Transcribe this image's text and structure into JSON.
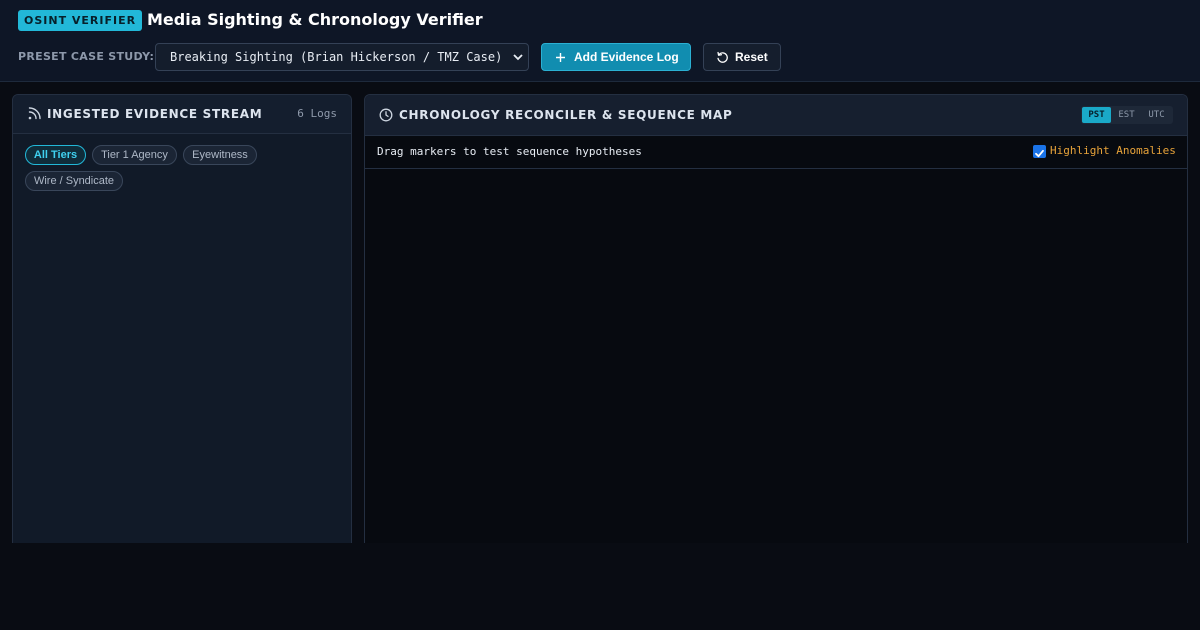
{
  "header": {
    "badge": "OSINT VERIFIER",
    "title": "Media Sighting & Chronology Verifier",
    "preset_label": "PRESET CASE STUDY:",
    "preset_selected": "Breaking Sighting (Brian Hickerson / TMZ Case)",
    "add_button": "Add Evidence Log",
    "reset_button": "Reset"
  },
  "left_panel": {
    "title": "INGESTED EVIDENCE STREAM",
    "count": "6 Logs",
    "filters": [
      "All Tiers",
      "Tier 1 Agency",
      "Eyewitness",
      "Wire / Syndicate"
    ],
    "active_filter": "All Tiers"
  },
  "right_panel": {
    "title": "CHRONOLOGY RECONCILER & SEQUENCE MAP",
    "timezones": [
      "PST",
      "EST",
      "UTC"
    ],
    "active_timezone": "PST",
    "hint": "Drag markers to test sequence hypotheses",
    "highlight_label": "Highlight Anomalies",
    "highlight_checked": true
  },
  "colors": {
    "accent": "#22b8d8",
    "primary_button": "#118db0",
    "warning": "#e8a33a",
    "background": "#090c13"
  },
  "icons": [
    "plus-icon",
    "reset-icon",
    "rss-feed-icon",
    "clock-icon",
    "chevron-down-icon",
    "checkbox-checked-icon"
  ]
}
